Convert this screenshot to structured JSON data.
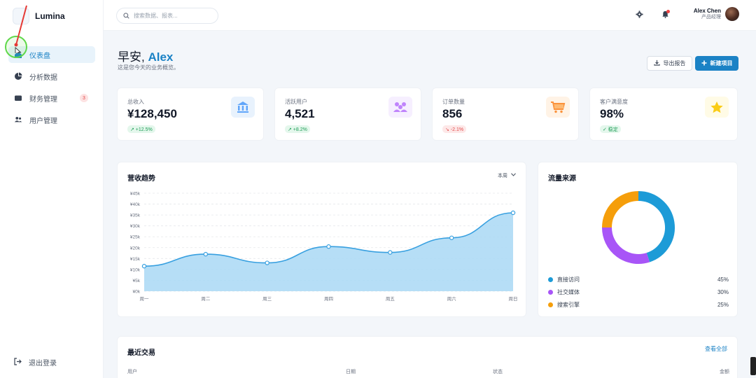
{
  "brand": {
    "name": "Lumina"
  },
  "sidebar": {
    "items": [
      {
        "label": "仪表盘",
        "icon": "home-icon",
        "active": true
      },
      {
        "label": "分析数据",
        "icon": "pie-chart-icon",
        "active": false
      },
      {
        "label": "财务管理",
        "icon": "wallet-icon",
        "active": false,
        "badge": "3"
      },
      {
        "label": "用户管理",
        "icon": "users-icon",
        "active": false
      }
    ],
    "logout_label": "退出登录"
  },
  "header": {
    "search_placeholder": "搜索数据、报表...",
    "user_name": "Alex Chen",
    "user_role": "产品经理"
  },
  "greeting": {
    "prefix": "早安, ",
    "name": "Alex",
    "subtitle": "这是您今天的业务概览。"
  },
  "actions": {
    "export_label": "导出报告",
    "new_label": "新建项目"
  },
  "stats": [
    {
      "label": "总收入",
      "value": "¥128,450",
      "trend": "↗ +12.5%",
      "trend_dir": "up",
      "icon": "bank-icon",
      "color": "#60a5fa"
    },
    {
      "label": "活跃用户",
      "value": "4,521",
      "trend": "↗ +8.2%",
      "trend_dir": "up",
      "icon": "users-icon",
      "color": "#c084fc"
    },
    {
      "label": "订单数量",
      "value": "856",
      "trend": "↘ -2.1%",
      "trend_dir": "down",
      "icon": "cart-icon",
      "color": "#fb923c"
    },
    {
      "label": "客户满意度",
      "value": "98%",
      "trend": "✓ 稳定",
      "trend_dir": "up",
      "icon": "star-icon",
      "color": "#facc15"
    }
  ],
  "revenue": {
    "title": "营收趋势",
    "period": "本周"
  },
  "chart_data": {
    "type": "area",
    "title": "营收趋势",
    "categories": [
      "周一",
      "周二",
      "周三",
      "周四",
      "周五",
      "周六",
      "周日"
    ],
    "values": [
      11500,
      17000,
      13000,
      20500,
      17800,
      24500,
      36000
    ],
    "y_ticks": [
      "¥0k",
      "¥5k",
      "¥10k",
      "¥15k",
      "¥20k",
      "¥25k",
      "¥30k",
      "¥35k",
      "¥40k",
      "¥45k"
    ],
    "ylim": [
      0,
      45000
    ],
    "grid": true,
    "color": "#38a0e0"
  },
  "traffic": {
    "title": "流量来源",
    "chart_data": {
      "type": "pie",
      "categories": [
        "直接访问",
        "社交媒体",
        "搜索引擎"
      ],
      "values": [
        45,
        30,
        25
      ],
      "labels": [
        "45%",
        "30%",
        "25%"
      ],
      "colors": [
        "#1d9bd7",
        "#a855f7",
        "#f59e0b"
      ]
    }
  },
  "transactions": {
    "title": "最近交易",
    "view_all": "查看全部",
    "columns": [
      "用户",
      "日期",
      "状态",
      "金额"
    ]
  }
}
